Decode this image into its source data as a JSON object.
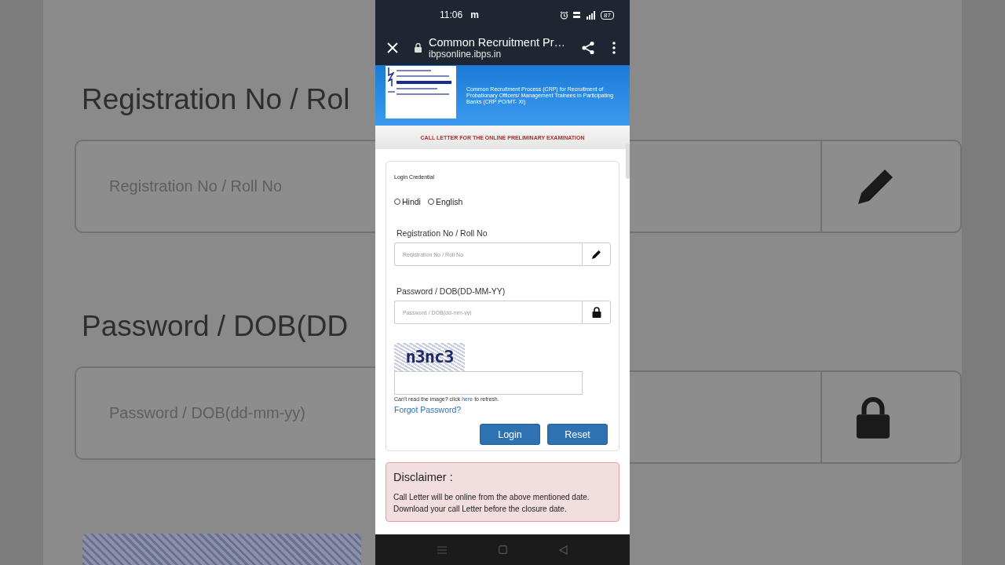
{
  "backdrop": {
    "registration_heading": "Registration No / Rol",
    "registration_placeholder": "Registration No / Roll No",
    "password_heading": "Password / DOB(DD",
    "password_placeholder": "Password / DOB(dd-mm-yy)"
  },
  "status_bar": {
    "time": "11:06",
    "notification": "m",
    "battery": "87"
  },
  "browser": {
    "page_title": "Common Recruitment Pr…",
    "url": "ibpsonline.ibps.in"
  },
  "banner": {
    "description": "Common Recruitment Process (CRP) for Recruitment of Probationary Officers/ Management Trainees in Participating Banks (CRP PO/MT- XI)"
  },
  "subtitle": "CALL LETTER FOR THE ONLINE PRELIMINARY EXAMINATION",
  "login": {
    "title": "Login Credential",
    "languages": [
      {
        "label": "Hindi",
        "selected": false
      },
      {
        "label": "English",
        "selected": false
      }
    ],
    "fields": [
      {
        "kind": "registration",
        "label": "Registration No / Roll No",
        "placeholder": "Registration No / Roll No"
      },
      {
        "kind": "password",
        "label": "Password / DOB(DD-MM-YY)",
        "placeholder": "Password / DOB(dd-mm-yy)"
      }
    ],
    "captcha": "n3nc3",
    "refresh_before": "Can't read the image? click",
    "refresh_link": "here",
    "refresh_after": "to refresh.",
    "forgot": "Forgot Password?",
    "buttons": [
      "Login",
      "Reset"
    ]
  },
  "disclaimer": {
    "title": "Disclaimer :",
    "text": "Call Letter will be online from the above mentioned date. Download your call Letter before the closure date."
  }
}
